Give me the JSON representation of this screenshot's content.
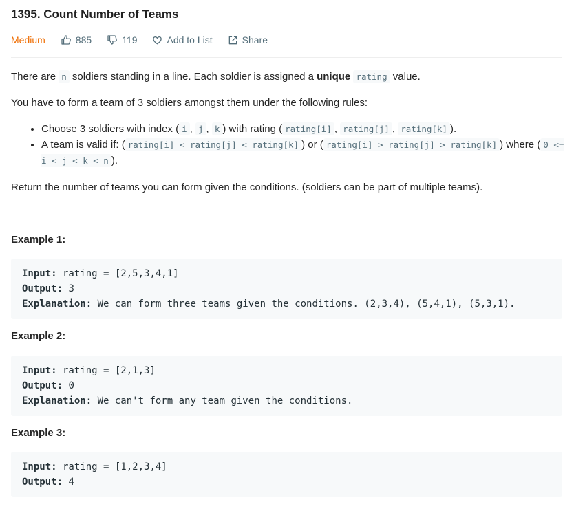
{
  "problem": {
    "title": "1395. Count Number of Teams",
    "difficulty": "Medium",
    "likes": "885",
    "dislikes": "119",
    "add_to_list": "Add to List",
    "share": "Share"
  },
  "description": {
    "p1_a": "There are ",
    "p1_code_n": "n",
    "p1_b": " soldiers standing in a line. Each soldier is assigned a ",
    "p1_unique": "unique",
    "p1_code_rating": "rating",
    "p1_c": " value.",
    "p2": "You have to form a team of 3 soldiers amongst them under the following rules:",
    "rule1_a": "Choose 3 soldiers with index (",
    "rule1_i": "i",
    "rule1_j": "j",
    "rule1_k": "k",
    "rule1_b": ") with rating (",
    "rule1_ri": "rating[i]",
    "rule1_rj": "rating[j]",
    "rule1_rk": "rating[k]",
    "rule1_c": ").",
    "rule2_a": "A team is valid if: (",
    "rule2_code1": "rating[i] < rating[j] < rating[k]",
    "rule2_b": ") or (",
    "rule2_code2": "rating[i] > rating[j] > rating[k]",
    "rule2_c": ") where (",
    "rule2_code3": "0 <= i < j < k < n",
    "rule2_d": ").",
    "p3": "Return the number of teams you can form given the conditions. (soldiers can be part of multiple teams)."
  },
  "examples": [
    {
      "title": "Example 1:",
      "input_label": "Input:",
      "input": " rating = [2,5,3,4,1]",
      "output_label": "Output:",
      "output": " 3",
      "explanation_label": "Explanation:",
      "explanation": " We can form three teams given the conditions. (2,3,4), (5,4,1), (5,3,1)."
    },
    {
      "title": "Example 2:",
      "input_label": "Input:",
      "input": " rating = [2,1,3]",
      "output_label": "Output:",
      "output": " 0",
      "explanation_label": "Explanation:",
      "explanation": " We can't form any team given the conditions."
    },
    {
      "title": "Example 3:",
      "input_label": "Input:",
      "input": " rating = [1,2,3,4]",
      "output_label": "Output:",
      "output": " 4"
    }
  ],
  "colors": {
    "difficulty_medium": "#ef6c00",
    "meta_text": "#546e7a",
    "code_bg": "#f7f9fa"
  },
  "icons": {
    "likes": "thumbs-up-icon",
    "dislikes": "thumbs-down-icon",
    "add_to_list": "heart-icon",
    "share": "share-icon"
  }
}
